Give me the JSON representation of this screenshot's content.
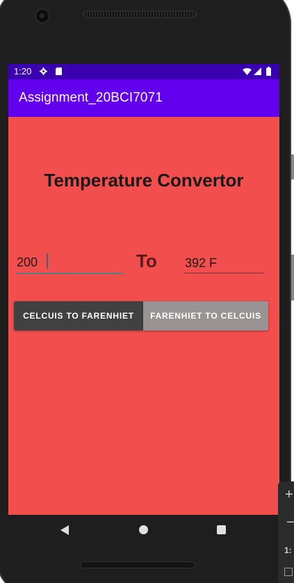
{
  "status_bar": {
    "time": "1:20",
    "icons": [
      "gear-icon",
      "sd-card-icon",
      "wifi-icon",
      "cell-signal-icon",
      "battery-icon"
    ]
  },
  "app_bar": {
    "title": "Assignment_20BCI7071",
    "color": "#6200ee"
  },
  "main": {
    "heading": "Temperature Convertor",
    "input_value": "200",
    "to_label": "To",
    "output_value": "392 F",
    "buttons": {
      "c_to_f": "CELCUIS TO FARENHIET",
      "f_to_c": "FARENHIET TO CELCUIS"
    },
    "background_color": "#f24e4e"
  },
  "nav_bar": {
    "icons": [
      "back-icon",
      "home-icon",
      "recents-icon"
    ]
  },
  "side_toolbar": {
    "icons": [
      "zoom-in-icon",
      "zoom-out-icon",
      "actual-size-icon",
      "fit-screen-icon"
    ],
    "actual_size_label": "1:"
  }
}
